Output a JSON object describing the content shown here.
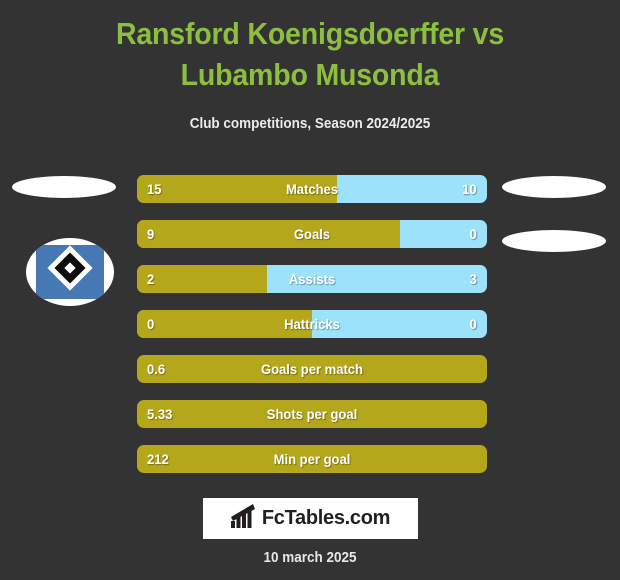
{
  "header": {
    "title": "Ransford Koenigsdoerffer vs Lubambo Musonda",
    "subtitle": "Club competitions, Season 2024/2025"
  },
  "colors": {
    "background": "#333333",
    "title_green": "#8cbf3f",
    "bar_gold": "#b5a71c",
    "bar_blue": "#9be2fa",
    "crest_blue": "#4678b4",
    "text_white": "#ffffff"
  },
  "crest": {
    "name": "hamburger-sv-crest"
  },
  "placeholders": [
    {
      "name": "player-photo-placeholder-left"
    },
    {
      "name": "player-photo-placeholder-right"
    },
    {
      "name": "club-crest-placeholder-right"
    }
  ],
  "chart_data": {
    "type": "bar",
    "title": "Ransford Koenigsdoerffer vs Lubambo Musonda",
    "subtitle": "Club competitions, Season 2024/2025",
    "orientation": "horizontal-diverging",
    "legend": {
      "left_series": "Ransford Koenigsdoerffer",
      "right_series": "Lubambo Musonda"
    },
    "left_color": "#b5a71c",
    "right_color": "#9be2fa",
    "categories": [
      "Matches",
      "Goals",
      "Assists",
      "Hattricks",
      "Goals per match",
      "Shots per goal",
      "Min per goal"
    ],
    "series": [
      {
        "name": "Ransford Koenigsdoerffer",
        "values": [
          "15",
          "9",
          "2",
          "0",
          "0.6",
          "5.33",
          "212"
        ]
      },
      {
        "name": "Lubambo Musonda",
        "values": [
          "10",
          "0",
          "3",
          "0",
          null,
          null,
          null
        ]
      }
    ],
    "rows": [
      {
        "label": "Matches",
        "left": "15",
        "right": "10",
        "left_pct": 57,
        "dual": true
      },
      {
        "label": "Goals",
        "left": "9",
        "right": "0",
        "left_pct": 75,
        "dual": true
      },
      {
        "label": "Assists",
        "left": "2",
        "right": "3",
        "left_pct": 37,
        "dual": true
      },
      {
        "label": "Hattricks",
        "left": "0",
        "right": "0",
        "left_pct": 50,
        "dual": true
      },
      {
        "label": "Goals per match",
        "left": "0.6",
        "right": "",
        "left_pct": 100,
        "dual": false
      },
      {
        "label": "Shots per goal",
        "left": "5.33",
        "right": "",
        "left_pct": 100,
        "dual": false
      },
      {
        "label": "Min per goal",
        "left": "212",
        "right": "",
        "left_pct": 100,
        "dual": false
      }
    ]
  },
  "footer": {
    "logo_text": "FcTables.com",
    "logo_icon": "bar-chart-icon",
    "date": "10 march 2025"
  }
}
